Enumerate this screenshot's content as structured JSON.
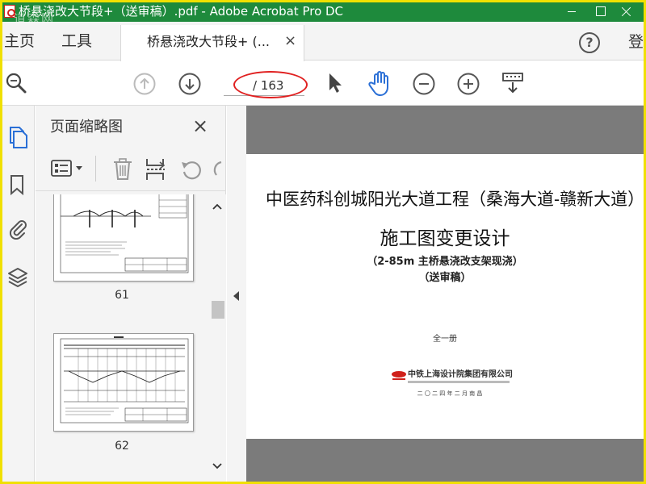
{
  "window": {
    "title": "桥悬浇改大节段+（送审稿）.pdf - Adobe Acrobat Pro DC",
    "watermark": "道森网"
  },
  "menubar": {
    "home": "主页",
    "tools": "工具",
    "tab_label": "桥悬浇改大节段+ (...",
    "tab_close": "×",
    "help": "?",
    "login": "登"
  },
  "toolbar": {
    "page_total": "/ 163"
  },
  "panel": {
    "title": "页面缩略图",
    "close": "×",
    "thumbnails": [
      {
        "label": "61"
      },
      {
        "label": "62"
      }
    ]
  },
  "document": {
    "project_title": "中医药科创城阳光大道工程（桑海大道-赣新大道）",
    "main_title": "施工图变更设计",
    "subtitle_1": "（2-85m 主桥悬浇改支架现浇）",
    "subtitle_2": "（送审稿）",
    "volume": "全一册",
    "company": "中铁上海设计院集团有限公司",
    "date": "二 〇 二 四 年    二 月    南 昌"
  },
  "colors": {
    "titlebar": "#1e8a3c",
    "frame_border": "#f0e000",
    "annotation_ellipse": "#e02020",
    "hand_tool": "#2a6fd6",
    "page_icon": "#2a6fd6",
    "doc_background": "#7b7b7b"
  }
}
